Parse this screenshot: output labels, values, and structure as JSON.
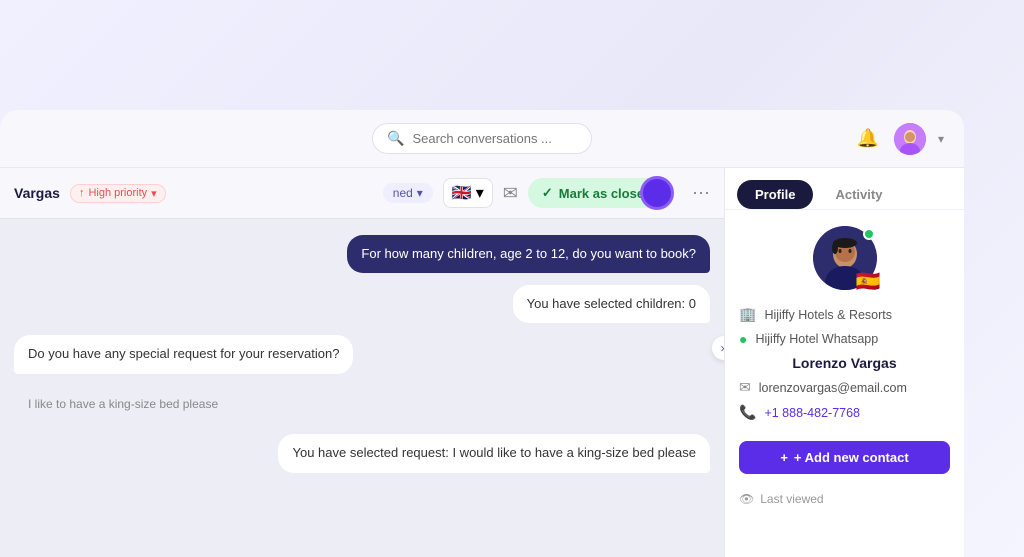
{
  "app": {
    "bg_color": "#f0f0fa"
  },
  "topbar": {
    "search_placeholder": "Search conversations ...",
    "bell_label": "notifications",
    "chevron_label": "▾"
  },
  "chat_header": {
    "contact_name": "Vargas",
    "priority_label": "High priority",
    "priority_arrow": "▾",
    "assigned_label": "ned",
    "assigned_arrow": "▾",
    "mark_closed_label": "Mark as closed",
    "check_symbol": "✓"
  },
  "messages": [
    {
      "text": "For how many children, age 2 to 12, do you want to book?",
      "type": "bot"
    },
    {
      "text": "You have selected children: 0",
      "type": "system"
    },
    {
      "text": "Do you have any special request for your reservation?",
      "type": "bot"
    },
    {
      "text": "I like to have a king-size bed please",
      "type": "user_note"
    },
    {
      "text": "You have selected request: I would like to have a king-size bed please",
      "type": "system"
    }
  ],
  "right_panel": {
    "tabs": [
      {
        "label": "Profile",
        "active": true
      },
      {
        "label": "Activity",
        "active": false
      }
    ],
    "profile": {
      "company": "Hijiffy Hotels & Resorts",
      "channel": "Hijiffy Hotel Whatsapp",
      "name": "Lorenzo Vargas",
      "email": "lorenzovargas@email.com",
      "phone": "+1 888-482-7768",
      "flag": "🇪🇸",
      "add_contact_label": "+ Add new contact",
      "last_viewed_label": "Last viewed"
    }
  },
  "icons": {
    "search": "🔍",
    "bell": "🔔",
    "building": "🏢",
    "whatsapp": "💬",
    "email": "✉",
    "phone": "📞",
    "eye": "👁",
    "plus": "+",
    "check": "✓",
    "dots": "⋯",
    "arrows_left": "«",
    "chevron_down": "▾"
  }
}
